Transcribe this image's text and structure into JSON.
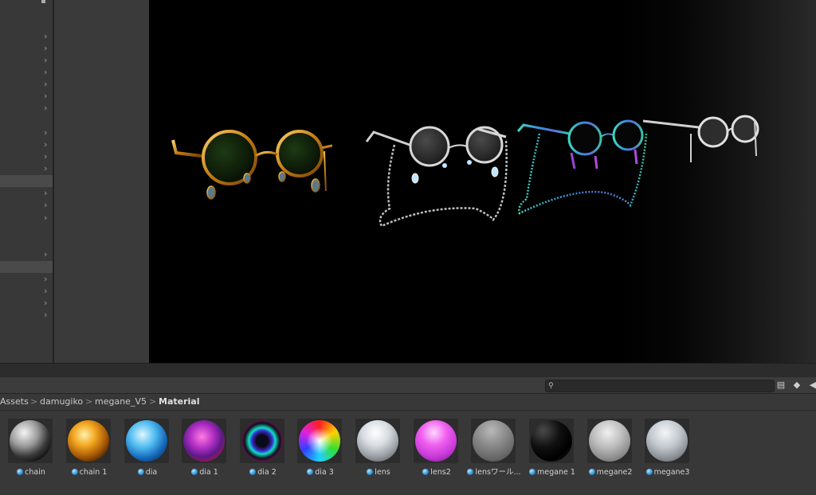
{
  "breadcrumb": {
    "items": [
      "Assets",
      "damugiko",
      "megane_V5",
      "Material"
    ],
    "separator": ">"
  },
  "search": {
    "value": "",
    "placeholder": ""
  },
  "assets": [
    {
      "label": "chain",
      "icon": "material-icon"
    },
    {
      "label": "chain 1",
      "icon": "material-icon"
    },
    {
      "label": "dia",
      "icon": "material-icon"
    },
    {
      "label": "dia 1",
      "icon": "material-icon"
    },
    {
      "label": "dia 2",
      "icon": "material-icon"
    },
    {
      "label": "dia 3",
      "icon": "material-icon"
    },
    {
      "label": "lens",
      "icon": "material-icon"
    },
    {
      "label": "lens2",
      "icon": "material-icon"
    },
    {
      "label": "lensワール...",
      "icon": "material-icon"
    },
    {
      "label": "megane 1",
      "icon": "material-icon"
    },
    {
      "label": "megane2",
      "icon": "material-icon"
    },
    {
      "label": "megane3",
      "icon": "material-icon"
    }
  ],
  "toolbar": {
    "icons": [
      "search-icon",
      "create-icon",
      "filter-by-label-icon",
      "collapse-icon"
    ]
  },
  "colors": {
    "scene_background": "#000000",
    "editor_panel": "#383838",
    "gold_frame": "#d08a1c",
    "silver_frame": "#c8c8c8",
    "rainbow_frame": "#4fd3c8"
  }
}
